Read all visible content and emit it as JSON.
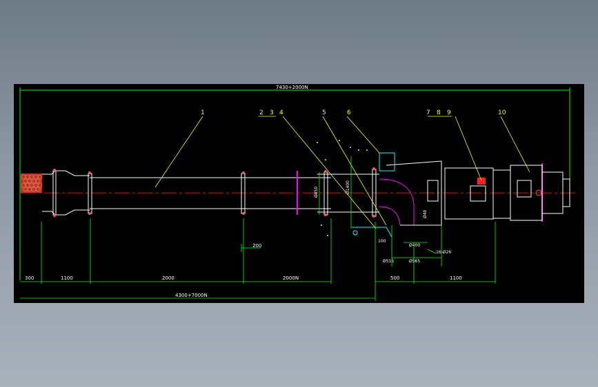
{
  "drawing": {
    "overall_top": "7430+2000N",
    "overall_bottom": "4300+7000N",
    "bottom_dims": [
      "300",
      "1100",
      "2000",
      "2000N",
      "500",
      "1100"
    ],
    "gap_dim": "200",
    "vertical_dims": [
      "Ø850",
      "Ø1400",
      "Ø40"
    ],
    "port_dims": [
      "100",
      "Ø400",
      "Ø515",
      "Ø565",
      "16-Ø26"
    ],
    "callouts": [
      "1",
      "2",
      "3",
      "4",
      "5",
      "6",
      "7",
      "8",
      "9",
      "10"
    ]
  },
  "colors": {
    "background": "#000000",
    "outline": "#ffffff",
    "dimension": "#00ff00",
    "centerline": "#ff0000",
    "callout": "#ffff00",
    "flange": "#ff00ff",
    "detail": "#00ffff"
  }
}
